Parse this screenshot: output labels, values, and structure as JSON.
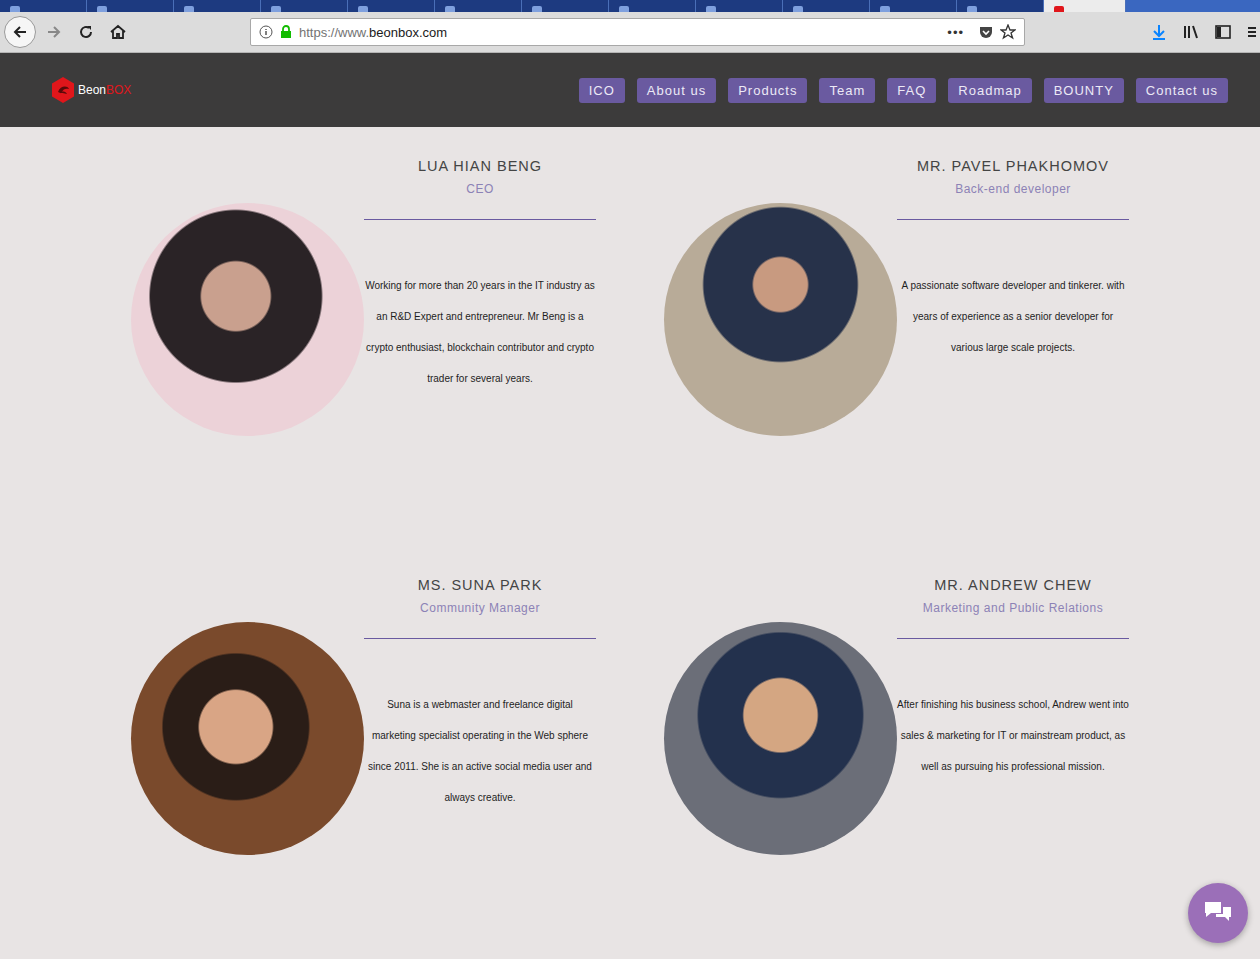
{
  "browser": {
    "tabs": [
      {
        "selected": false
      },
      {
        "selected": false
      },
      {
        "selected": false
      },
      {
        "selected": false
      },
      {
        "selected": false
      },
      {
        "selected": false
      },
      {
        "selected": false
      },
      {
        "selected": false
      },
      {
        "selected": false
      },
      {
        "selected": false
      },
      {
        "selected": false
      },
      {
        "selected": false
      },
      {
        "selected": true
      }
    ],
    "url_prefix": "https://www.",
    "url_domain": "beonbox.com",
    "page_actions": "•••"
  },
  "site": {
    "logo_first": "Beon",
    "logo_second": "BOX",
    "nav": [
      "ICO",
      "About us",
      "Products",
      "Team",
      "FAQ",
      "Roadmap",
      "BOUNTY",
      "Contact us"
    ]
  },
  "team": [
    {
      "name": "LUA HIAN BENG",
      "role": "CEO",
      "bio": "Working for more than 20 years in the IT industry as an R&D Expert and entrepreneur. Mr Beng is a crypto enthusiast, blockchain contributor and crypto trader for several years."
    },
    {
      "name": "MR. PAVEL PHAKHOMOV",
      "role": "Back-end developer",
      "bio": "A passionate software developer and tinkerer. with years of experience as a senior developer for various large scale projects."
    },
    {
      "name": "MS. SUNA PARK",
      "role": "Community Manager",
      "bio": "Suna is a webmaster and freelance digital marketing specialist operating in the Web sphere since 2011. She is an active social media user and always creative."
    },
    {
      "name": "MR. ANDREW CHEW",
      "role": "Marketing and Public Relations",
      "bio": "After finishing his business school, Andrew went into sales & marketing for IT or mainstream product, as well as pursuing his professional mission."
    }
  ]
}
